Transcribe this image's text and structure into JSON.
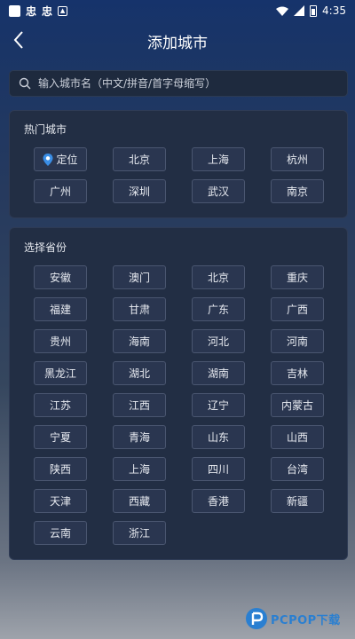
{
  "status": {
    "time": "4:35",
    "notif_icons": [
      "忠",
      "忠"
    ]
  },
  "header": {
    "title": "添加城市"
  },
  "search": {
    "placeholder": "输入城市名（中文/拼音/首字母缩写）"
  },
  "hot": {
    "title": "热门城市",
    "items": [
      "定位",
      "北京",
      "上海",
      "杭州",
      "广州",
      "深圳",
      "武汉",
      "南京"
    ]
  },
  "provinces": {
    "title": "选择省份",
    "items": [
      "安徽",
      "澳门",
      "北京",
      "重庆",
      "福建",
      "甘肃",
      "广东",
      "广西",
      "贵州",
      "海南",
      "河北",
      "河南",
      "黑龙江",
      "湖北",
      "湖南",
      "吉林",
      "江苏",
      "江西",
      "辽宁",
      "内蒙古",
      "宁夏",
      "青海",
      "山东",
      "山西",
      "陕西",
      "上海",
      "四川",
      "台湾",
      "天津",
      "西藏",
      "香港",
      "新疆",
      "云南",
      "浙江"
    ]
  },
  "watermark": {
    "text": "PCPOP下载"
  },
  "colors": {
    "accent": "#3a8ee6",
    "panel": "#222e44",
    "chip": "#2a3650"
  }
}
